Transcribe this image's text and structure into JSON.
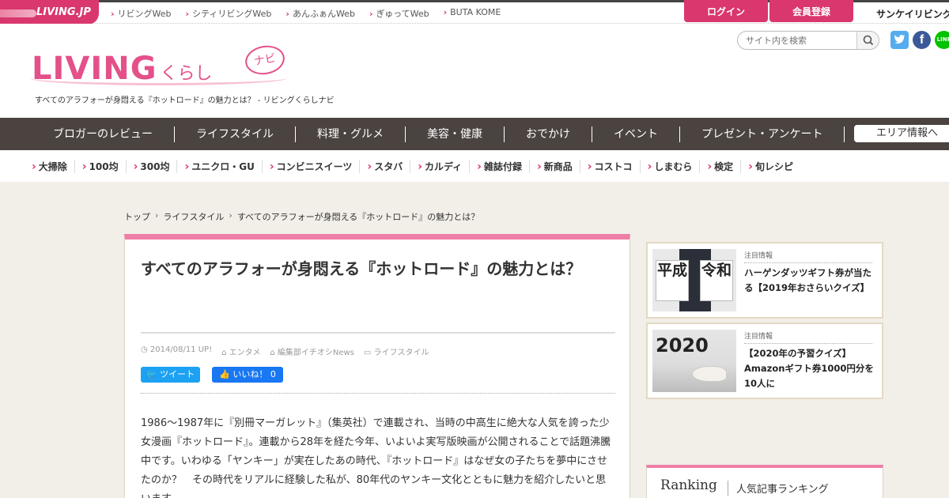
{
  "top_bar": {
    "logo": "LIVING.JP",
    "links": [
      "リビングWeb",
      "シティリビングWeb",
      "あんふぁんWeb",
      "ぎゅってWeb",
      "BUTA KOME"
    ],
    "login": "ログイン",
    "register": "会員登録",
    "partner": "サンケイリビング"
  },
  "header": {
    "logo_main": "LIVING",
    "logo_sub": "くらし",
    "logo_badge": "ナビ",
    "tagline": "すべてのアラフォーが身悶える『ホットロード』の魅力とは？ - リビングくらしナビ",
    "search_placeholder": "サイト内を検索",
    "social": {
      "twitter": "twitter-icon",
      "facebook": "facebook-icon",
      "line": "line-icon"
    }
  },
  "main_nav": {
    "items": [
      "ブロガーのレビュー",
      "ライフスタイル",
      "料理・グルメ",
      "美容・健康",
      "おでかけ",
      "イベント",
      "プレゼント・アンケート"
    ],
    "area": "エリア情報へ"
  },
  "sub_nav": [
    "大掃除",
    "100均",
    "300均",
    "ユニクロ・GU",
    "コンビニスイーツ",
    "スタバ",
    "カルディ",
    "雑誌付録",
    "新商品",
    "コストコ",
    "しまむら",
    "検定",
    "旬レシピ"
  ],
  "breadcrumb": [
    "トップ",
    "ライフスタイル",
    "すべてのアラフォーが身悶える『ホットロード』の魅力とは？"
  ],
  "article": {
    "title": "すべてのアラフォーが身悶える『ホットロード』の魅力とは？",
    "date": "2014/08/11 UP!",
    "tag1": "エンタメ",
    "tag2": "編集部イチオシNews",
    "category": "ライフスタイル",
    "tweet": "ツイート",
    "like": "いいね！ 0",
    "body": "1986～1987年に『別冊マーガレット』（集英社）で連載され、当時の中高生に絶大な人気を誇った少女漫画『ホットロード』。連載から28年を経た今年、いよいよ実写版映画が公開されることで話題沸騰中です。いわゆる「ヤンキー」が実在したあの時代、『ホットロード』はなぜ女の子たちを夢中にさせたのか？　その時代をリアルに経験した私が、80年代のヤンキー文化とともに魅力を紹介したいと思います。"
  },
  "sidebar": {
    "cards": [
      {
        "label": "注目情報",
        "title": "ハーゲンダッツギフト券が当たる【2019年おさらいクイズ】",
        "sign_left": "平成",
        "sign_right": "令和"
      },
      {
        "label": "注目情報",
        "title": "【2020年の予習クイズ】Amazonギフト券1000円分を10人に",
        "year": "2020"
      }
    ],
    "ranking_en": "Ranking",
    "ranking_jp": "人気記事ランキング"
  }
}
